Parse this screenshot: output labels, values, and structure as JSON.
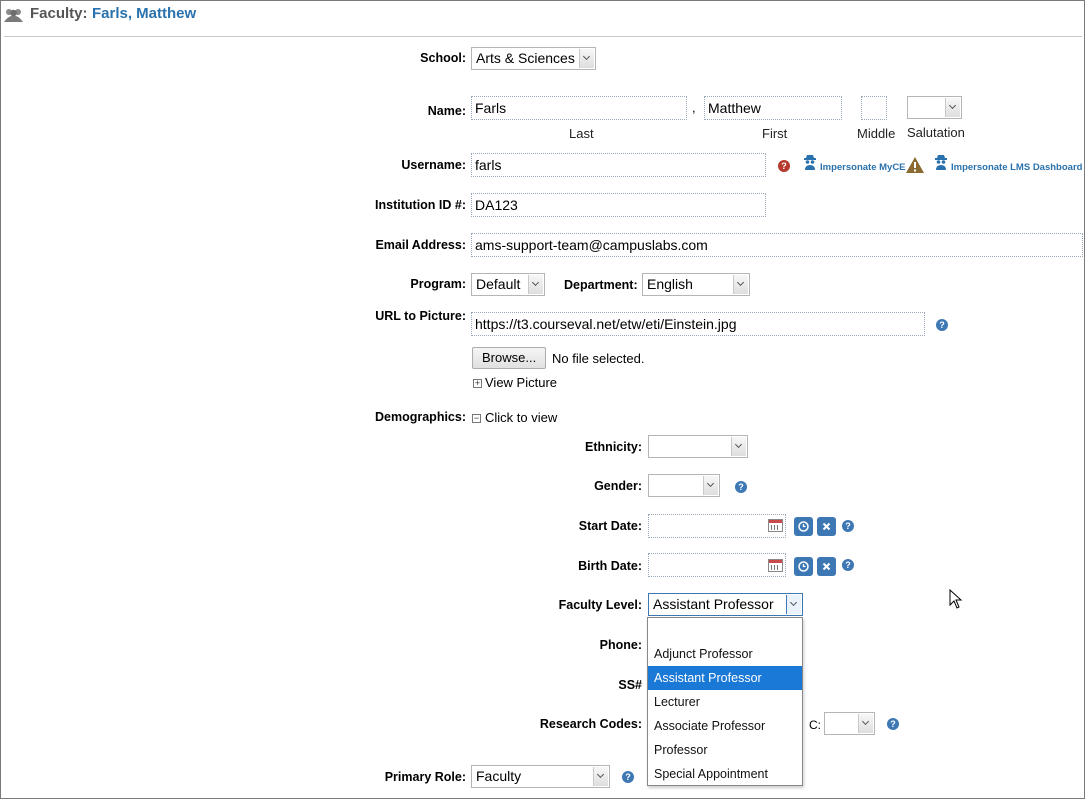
{
  "header": {
    "label": "Faculty:",
    "name": "Farls, Matthew"
  },
  "school": {
    "label": "School:",
    "value": "Arts & Sciences"
  },
  "name": {
    "label": "Name:",
    "last": "Farls",
    "first": "Matthew",
    "middle": "",
    "salutation": "",
    "separator": ",",
    "last_caption": "Last",
    "first_caption": "First",
    "middle_caption": "Middle",
    "salutation_caption": "Salutation"
  },
  "username": {
    "label": "Username:",
    "value": "farls",
    "impersonate_myce": "Impersonate MyCE",
    "impersonate_lms": "Impersonate LMS Dashboard"
  },
  "institution_id": {
    "label": "Institution ID #:",
    "value": "DA123"
  },
  "email": {
    "label": "Email Address:",
    "value": "ams-support-team@campuslabs.com"
  },
  "program": {
    "label": "Program:",
    "value": "Default"
  },
  "department": {
    "label": "Department:",
    "value": "English"
  },
  "picture": {
    "label": "URL to Picture:",
    "url": "https://t3.courseval.net/etw/eti/Einstein.jpg",
    "browse_label": "Browse...",
    "file_status": "No file selected.",
    "view_label": "View Picture"
  },
  "demographics": {
    "label": "Demographics:",
    "toggle_label": "Click to view",
    "ethnicity_label": "Ethnicity:",
    "gender_label": "Gender:",
    "start_date_label": "Start Date:",
    "birth_date_label": "Birth Date:",
    "faculty_level_label": "Faculty Level:",
    "faculty_level_value": "Assistant Professor",
    "phone_label": "Phone:",
    "ss_label": "SS#",
    "research_codes_label": "Research Codes:",
    "research_c_label": "C:"
  },
  "faculty_level_options": [
    "",
    "Adjunct Professor",
    "Assistant Professor",
    "Lecturer",
    "Associate Professor",
    "Professor",
    "Special Appointment"
  ],
  "selected_option_index": 2,
  "primary_role": {
    "label": "Primary Role:",
    "value": "Faculty"
  },
  "colors": {
    "accent": "#2a72ad",
    "help": "#3d78b5",
    "warning": "#b53a2d",
    "highlight": "#1a78d6"
  }
}
